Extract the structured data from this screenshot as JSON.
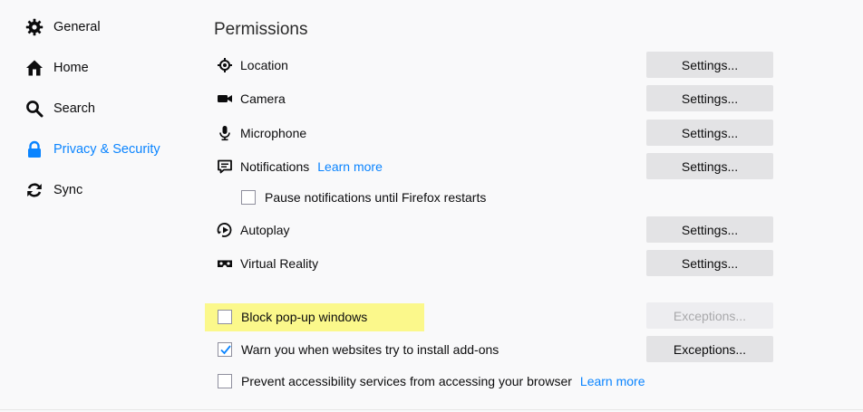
{
  "sidebar": {
    "items": [
      {
        "label": "General",
        "icon": "gear-icon"
      },
      {
        "label": "Home",
        "icon": "home-icon"
      },
      {
        "label": "Search",
        "icon": "search-icon"
      },
      {
        "label": "Privacy & Security",
        "icon": "lock-icon",
        "selected": true
      },
      {
        "label": "Sync",
        "icon": "sync-icon"
      }
    ]
  },
  "permissions": {
    "title": "Permissions",
    "rows": [
      {
        "label": "Location",
        "icon": "location-icon",
        "button": "Settings..."
      },
      {
        "label": "Camera",
        "icon": "camera-icon",
        "button": "Settings..."
      },
      {
        "label": "Microphone",
        "icon": "microphone-icon",
        "button": "Settings..."
      },
      {
        "label": "Notifications",
        "icon": "notifications-icon",
        "button": "Settings...",
        "learn_more": "Learn more"
      },
      {
        "label": "Autoplay",
        "icon": "autoplay-icon",
        "button": "Settings..."
      },
      {
        "label": "Virtual Reality",
        "icon": "vr-headset-icon",
        "button": "Settings..."
      }
    ],
    "pause_notifications": {
      "label": "Pause notifications until Firefox restarts",
      "checked": false
    },
    "block_popups": {
      "label": "Block pop-up windows",
      "checked": false,
      "button": "Exceptions...",
      "button_disabled": true,
      "highlight_color": "#fbf88b"
    },
    "warn_addons": {
      "label": "Warn you when websites try to install add-ons",
      "checked": true,
      "button": "Exceptions..."
    },
    "accessibility": {
      "label": "Prevent accessibility services from accessing your browser",
      "checked": false,
      "learn_more": "Learn more"
    }
  },
  "colors": {
    "accent": "#0a84ff",
    "button_bg": "#e3e3e5",
    "page_bg": "#f9f9fa"
  }
}
